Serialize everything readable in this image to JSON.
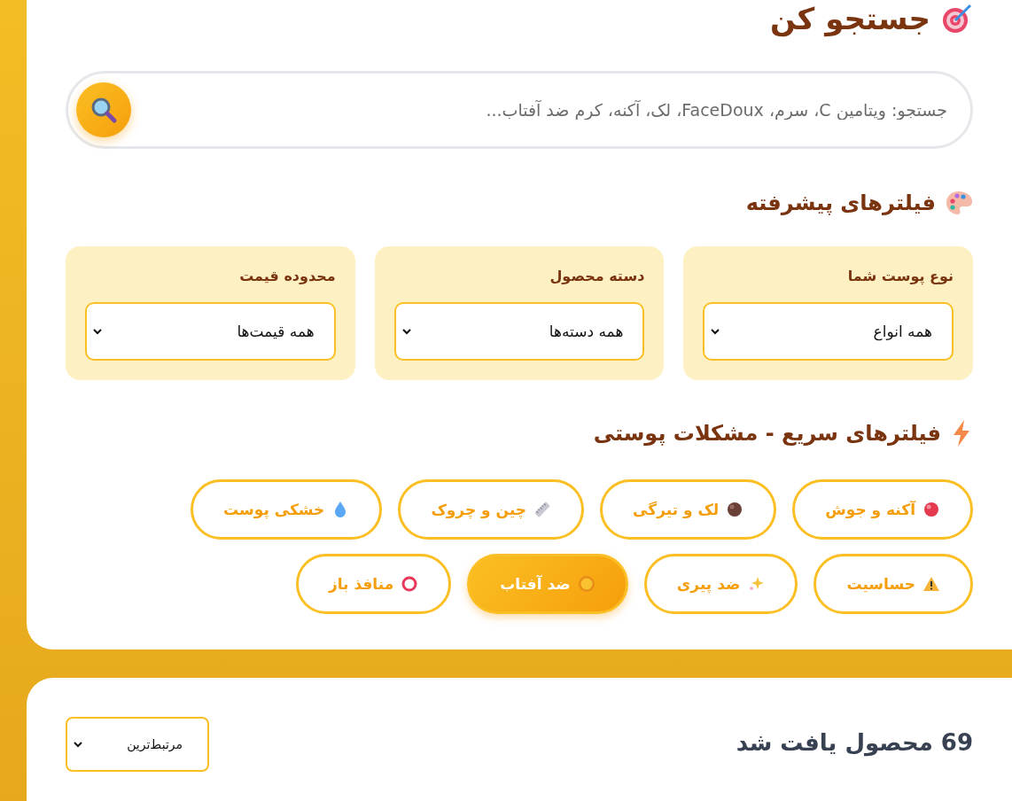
{
  "search_section": {
    "title": "جستجو کن",
    "search": {
      "placeholder": "جستجو: ویتامین C، سرم، FaceDoux، لک، آکنه، کرم ضد آفتاب..."
    }
  },
  "advanced_filters": {
    "title": "فیلترهای پیشرفته",
    "filters": [
      {
        "label": "نوع پوست شما",
        "value": "همه انواع"
      },
      {
        "label": "دسته محصول",
        "value": "همه دسته‌ها"
      },
      {
        "label": "محدوده قیمت",
        "value": "همه قیمت‌ها"
      }
    ]
  },
  "quick_filters": {
    "title": "فیلترهای سریع - مشکلات پوستی",
    "chips": [
      {
        "label": "آکنه و جوش",
        "kind": "red-ball",
        "selected": false
      },
      {
        "label": "لک و تیرگی",
        "kind": "brown-ball",
        "selected": false
      },
      {
        "label": "چین و چروک",
        "kind": "ruler",
        "selected": false
      },
      {
        "label": "خشکی پوست",
        "kind": "droplet",
        "selected": false
      },
      {
        "label": "حساسیت",
        "kind": "warning",
        "selected": false
      },
      {
        "label": "ضد پیری",
        "kind": "sparkles",
        "selected": false
      },
      {
        "label": "ضد آفتاب",
        "kind": "sun",
        "selected": true
      },
      {
        "label": "منافذ باز",
        "kind": "ring",
        "selected": false
      }
    ]
  },
  "results": {
    "count_text": "69 محصول یافت شد",
    "sort": "مرتبط‌ترین"
  }
}
